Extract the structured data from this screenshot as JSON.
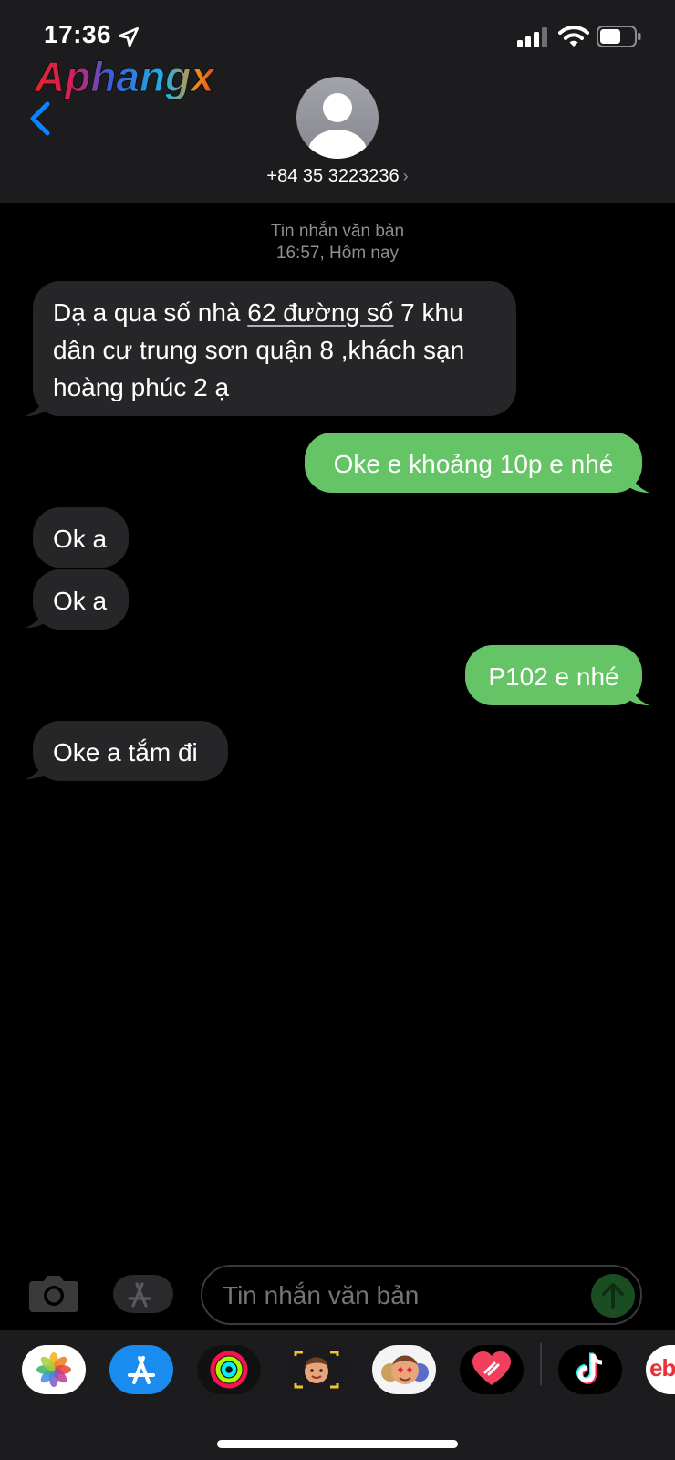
{
  "status_bar": {
    "time": "17:36"
  },
  "watermark": {
    "text": "Aphangx"
  },
  "header": {
    "contact": "+84 35 3223236",
    "chevron": "›"
  },
  "conversation": {
    "type_label": "Tin nhắn văn bản",
    "timestamp": "16:57, Hôm nay",
    "messages": [
      {
        "direction": "incoming",
        "parts": [
          "Dạ a qua số nhà ",
          "62 đường số",
          " 7 khu",
          "dân cư trung sơn quận 8 ,khách sạn",
          "hoàng phúc 2 ạ"
        ]
      },
      {
        "direction": "outgoing",
        "text": "Oke e khoảng 10p e nhé"
      },
      {
        "direction": "incoming",
        "text": "Ok a"
      },
      {
        "direction": "incoming",
        "text": "Ok a"
      },
      {
        "direction": "outgoing",
        "text": "P102 e nhé"
      },
      {
        "direction": "incoming",
        "text": "Oke a tắm đi"
      }
    ]
  },
  "composer": {
    "placeholder": "Tin nhắn văn bản"
  },
  "app_drawer": {
    "apps": [
      "photos-icon",
      "app-store-icon",
      "activity-icon",
      "memoji-icon",
      "animoji-icon",
      "digital-touch-icon",
      "tiktok-icon",
      "ebay-icon"
    ],
    "ebay_label": "eb"
  },
  "colors": {
    "outgoing": "#65c466",
    "incoming": "#262629",
    "accent": "#0a84ff"
  }
}
